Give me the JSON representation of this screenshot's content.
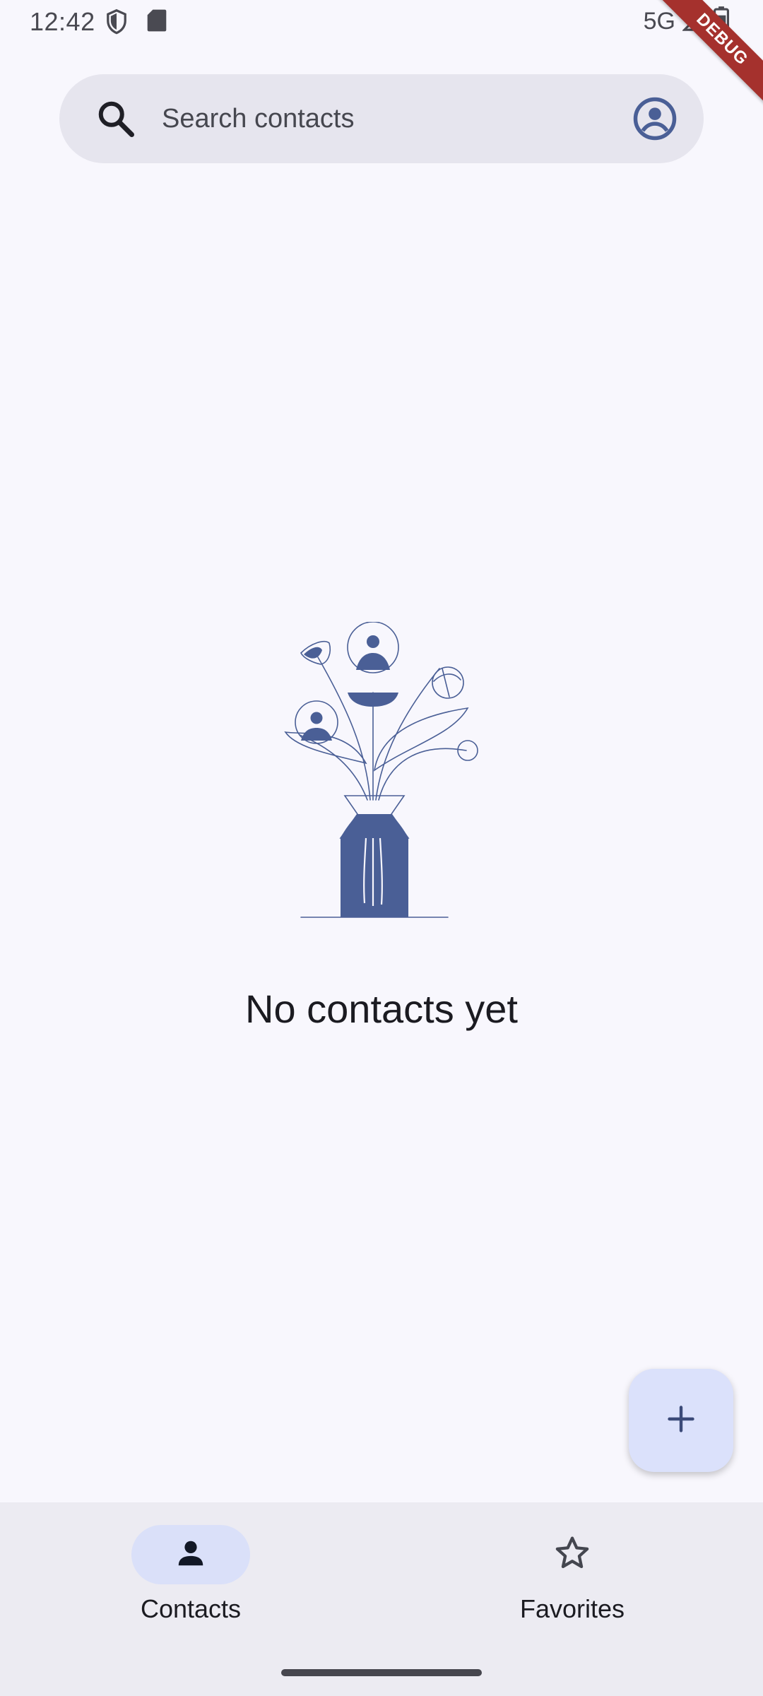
{
  "status_bar": {
    "time": "12:42",
    "network": "5G",
    "icons": [
      "shield-icon",
      "sd-card-icon",
      "signal-icon",
      "battery-icon"
    ]
  },
  "debug_banner": {
    "label": "DEBUG"
  },
  "search": {
    "placeholder": "Search contacts",
    "value": "",
    "leading_icon": "search-icon",
    "trailing_icon": "account-circle-icon"
  },
  "empty_state": {
    "illustration": "flower-vase-illustration",
    "message": "No contacts yet"
  },
  "fab": {
    "icon": "add-icon"
  },
  "bottom_nav": {
    "items": [
      {
        "label": "Contacts",
        "icon": "person-icon",
        "selected": true
      },
      {
        "label": "Favorites",
        "icon": "star-outline-icon",
        "selected": false
      }
    ]
  },
  "colors": {
    "background": "#f8f7fd",
    "search_bar": "#e6e5ee",
    "accent": "#4a5f96",
    "nav_background": "#ecebf2",
    "nav_indicator": "#dae0f9",
    "fab": "#dbe1fb",
    "text": "#1b1b21",
    "debug_banner": "#a5312d"
  }
}
